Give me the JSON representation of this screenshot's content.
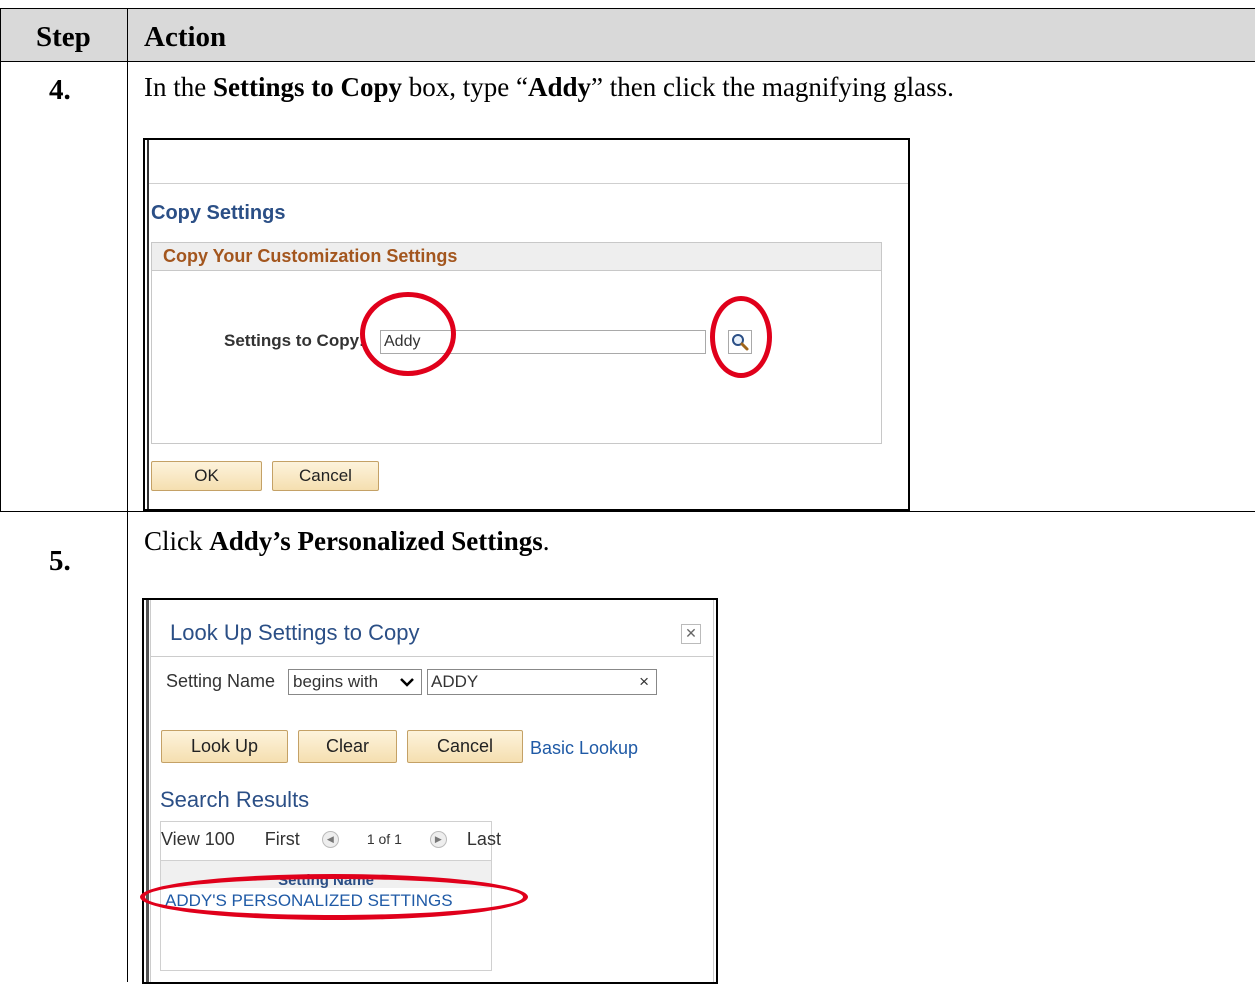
{
  "table": {
    "header_step": "Step",
    "header_action": "Action"
  },
  "step4": {
    "number": "4.",
    "instruction": {
      "pre": "In the ",
      "bold1": "Settings to Copy",
      "mid": " box, type “",
      "bold2": "Addy",
      "post": "” then click the magnifying glass."
    },
    "screenshot": {
      "page_title": "Copy Settings",
      "group_header": "Copy Your Customization Settings",
      "field_label": "Settings to Copy:",
      "field_value": "Addy",
      "lookup_icon": "magnifying-glass-icon",
      "ok_label": "OK",
      "cancel_label": "Cancel"
    }
  },
  "step5": {
    "number": "5.",
    "instruction": {
      "pre": "Click ",
      "bold1": "Addy’s Personalized Settings",
      "post": "."
    },
    "screenshot": {
      "modal_title": "Look Up Settings to Copy",
      "close_icon": "close-icon",
      "search_field_label": "Setting Name",
      "operator_value": "begins with",
      "search_value": "ADDY",
      "clear_icon": "×",
      "lookup_label": "Look Up",
      "clear_label": "Clear",
      "cancel_label": "Cancel",
      "basic_lookup_link": "Basic Lookup",
      "results_title": "Search Results",
      "view_label": "View 100",
      "first_label": "First",
      "row_count": "1 of 1",
      "last_label": "Last",
      "column_header": "Setting Name",
      "results": [
        "ADDY'S PERSONALIZED SETTINGS"
      ]
    }
  },
  "annotation_color": "#e0001b"
}
